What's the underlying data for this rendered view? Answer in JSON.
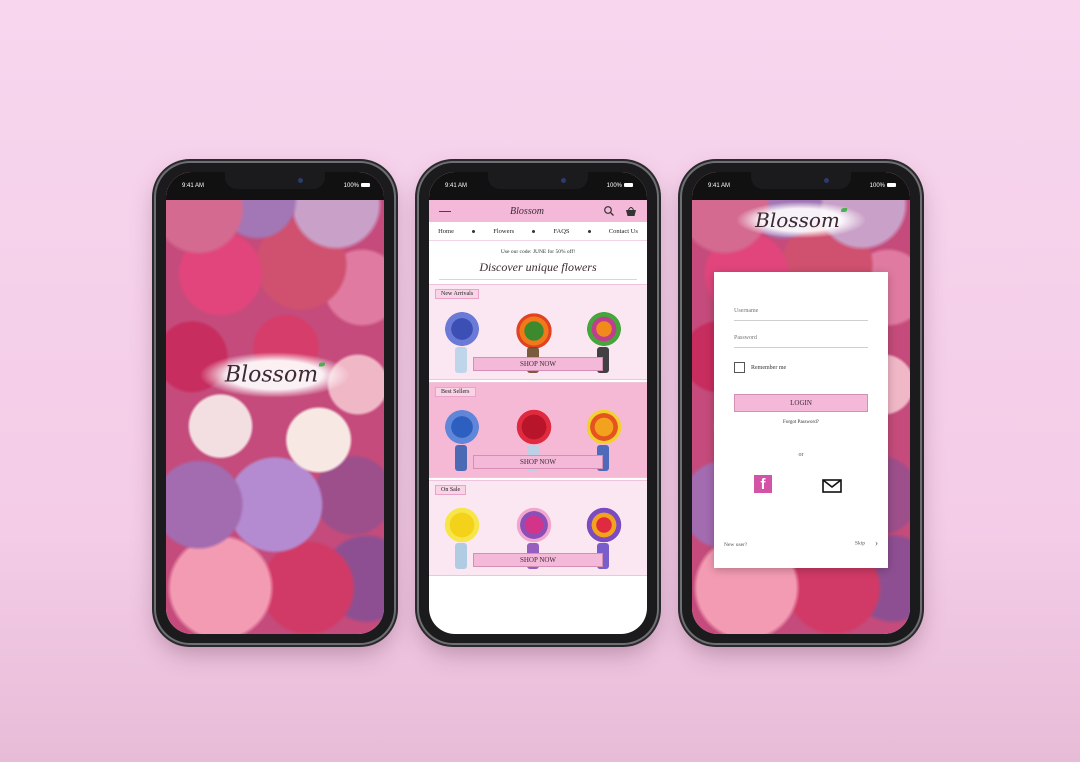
{
  "status": {
    "time": "9:41 AM",
    "battery": "100%"
  },
  "splash": {
    "logo": "Blossom"
  },
  "home": {
    "brand": "Blossom",
    "nav": [
      "Home",
      "Flowers",
      "FAQS",
      "Contact Us"
    ],
    "promo": "Use our code: JUNE for 50% off!",
    "headline": "Discover unique flowers",
    "sections": [
      {
        "tag": "New Arrivals",
        "cta": "SHOP NOW"
      },
      {
        "tag": "Best Sellers",
        "cta": "SHOP NOW"
      },
      {
        "tag": "On Sale",
        "cta": "SHOP NOW"
      }
    ]
  },
  "login": {
    "logo": "Blossom",
    "username_placeholder": "Username",
    "password_placeholder": "Password",
    "remember": "Remember me",
    "login_button": "LOGIN",
    "forgot": "Forgot Password?",
    "or": "or",
    "new_user": "New user?",
    "skip": "Skip"
  },
  "colors": {
    "accent_pink": "#f4b9d9",
    "facebook_pink": "#d354a6",
    "background": "#f7d6ee"
  },
  "icons": [
    "menu-icon",
    "search-icon",
    "basket-icon",
    "facebook-icon",
    "mail-icon",
    "chevron-right-icon"
  ]
}
